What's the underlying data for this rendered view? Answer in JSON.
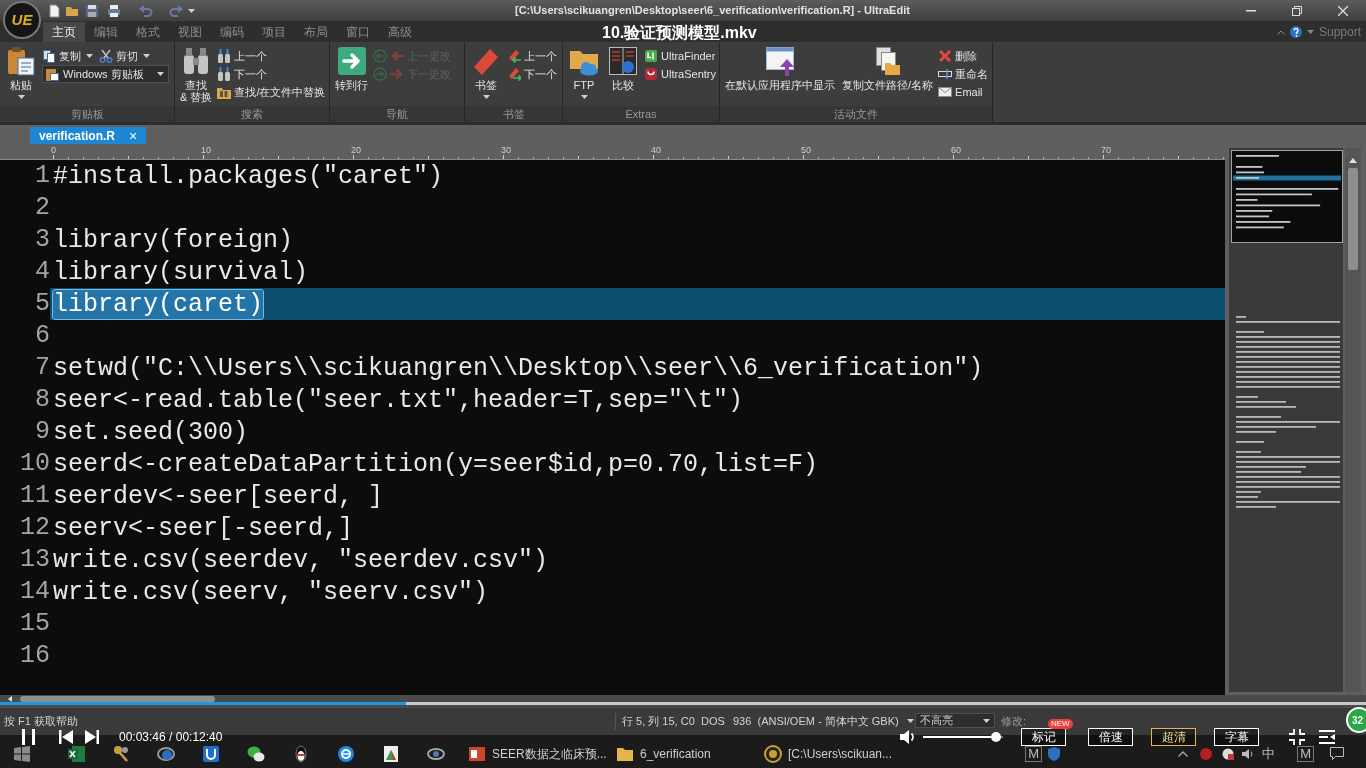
{
  "window": {
    "logo": "UE",
    "title": "[C:\\Users\\scikuangren\\Desktop\\seer\\6_verification\\verification.R] - UltraEdit"
  },
  "menu_tabs": [
    {
      "label": "主页",
      "selected": true
    },
    {
      "label": "编辑",
      "selected": false
    },
    {
      "label": "格式",
      "selected": false
    },
    {
      "label": "视图",
      "selected": false
    },
    {
      "label": "编码",
      "selected": false
    },
    {
      "label": "项目",
      "selected": false
    },
    {
      "label": "布局",
      "selected": false
    },
    {
      "label": "窗口",
      "selected": false
    },
    {
      "label": "高级",
      "selected": false
    }
  ],
  "support": {
    "label": "Support"
  },
  "ribbon": [
    {
      "label": "剪贴板",
      "columns": [
        {
          "kind": "large",
          "label": "粘贴",
          "dropdown": true
        },
        {
          "kind": "stack",
          "rows": [
            [
              {
                "kind": "button",
                "label": "复制",
                "dropdown": true
              },
              {
                "kind": "button",
                "label": "剪切",
                "dropdown": true
              }
            ],
            [
              {
                "kind": "combo",
                "label": "Windows 剪贴板"
              }
            ]
          ]
        }
      ]
    },
    {
      "label": "搜索",
      "columns": [
        {
          "kind": "large",
          "label": "查找\n& 替换"
        },
        {
          "kind": "stack",
          "rows": [
            [
              {
                "kind": "button",
                "label": "上一个"
              }
            ],
            [
              {
                "kind": "button",
                "label": "下一个"
              }
            ],
            [
              {
                "kind": "button",
                "label": "查找/在文件中替换"
              }
            ]
          ]
        }
      ]
    },
    {
      "label": "导航",
      "columns": [
        {
          "kind": "large",
          "label": "转到行"
        },
        {
          "kind": "stack",
          "rows": [
            [
              {
                "kind": "icon",
                "disabled": true
              }
            ],
            [
              {
                "kind": "icon",
                "disabled": true
              }
            ]
          ]
        },
        {
          "kind": "stack",
          "rows": [
            [
              {
                "kind": "button",
                "label": "上一更改",
                "disabled": true
              }
            ],
            [
              {
                "kind": "button",
                "label": "下一更改",
                "disabled": true
              }
            ]
          ]
        }
      ]
    },
    {
      "label": "书签",
      "columns": [
        {
          "kind": "large",
          "label": "书签",
          "dropdown": true
        },
        {
          "kind": "stack",
          "rows": [
            [
              {
                "kind": "button",
                "label": "上一个"
              }
            ],
            [
              {
                "kind": "button",
                "label": "下一个"
              }
            ]
          ]
        }
      ]
    },
    {
      "label": "Extras",
      "columns": [
        {
          "kind": "large",
          "label": "FTP",
          "dropdown": true
        },
        {
          "kind": "large",
          "label": "比较"
        },
        {
          "kind": "stack",
          "rows": [
            [
              {
                "kind": "button",
                "label": "UltraFinder"
              }
            ],
            [
              {
                "kind": "button",
                "label": "UltraSentry"
              }
            ]
          ]
        }
      ]
    },
    {
      "label": "活动文件",
      "columns": [
        {
          "kind": "large",
          "label": "在默认应用程序中显示"
        },
        {
          "kind": "large",
          "label": "复制文件路径/名称"
        },
        {
          "kind": "stack",
          "rows": [
            [
              {
                "kind": "button",
                "label": "删除"
              }
            ],
            [
              {
                "kind": "button",
                "label": "重命名"
              }
            ],
            [
              {
                "kind": "button",
                "label": "Email"
              }
            ]
          ]
        }
      ]
    }
  ],
  "file_tab": {
    "label": "verification.R",
    "close": "×"
  },
  "ruler": {
    "labels": [
      "0",
      "10",
      "20",
      "30",
      "40",
      "50",
      "60",
      "70"
    ]
  },
  "editor": {
    "lines": [
      {
        "number": "1",
        "text": "#install.packages(\"caret\")",
        "current": false,
        "selected": false
      },
      {
        "number": "2",
        "current": false,
        "selected": false
      },
      {
        "number": "3",
        "text": "library(foreign)",
        "current": false,
        "selected": false
      },
      {
        "number": "4",
        "text": "library(survival)",
        "current": false,
        "selected": false
      },
      {
        "number": "5",
        "text": "library(caret)",
        "current": true,
        "selected": true
      },
      {
        "number": "6",
        "current": false,
        "selected": false
      },
      {
        "number": "7",
        "text": "setwd(\"C:\\\\Users\\\\scikuangren\\\\Desktop\\\\seer\\\\6_verification\")",
        "current": false,
        "selected": false
      },
      {
        "number": "8",
        "text": "seer<-read.table(\"seer.txt\",header=T,sep=\"\\t\")",
        "current": false,
        "selected": false
      },
      {
        "number": "9",
        "text": "set.seed(300)",
        "current": false,
        "selected": false
      },
      {
        "number": "10",
        "text": "seerd<-createDataPartition(y=seer$id,p=0.70,list=F)",
        "current": false,
        "selected": false
      },
      {
        "number": "11",
        "text": "seerdev<-seer[seerd, ]",
        "current": false,
        "selected": false
      },
      {
        "number": "12",
        "text": "seerv<-seer[-seerd,]",
        "current": false,
        "selected": false
      },
      {
        "number": "13",
        "text": "write.csv(seerdev, \"seerdev.csv\")",
        "current": false,
        "selected": false
      },
      {
        "number": "14",
        "text": "write.csv(seerv, \"seerv.csv\")",
        "current": false,
        "selected": false
      },
      {
        "number": "15",
        "current": false,
        "selected": false
      },
      {
        "number": "16",
        "current": false,
        "selected": false
      }
    ]
  },
  "status_bar": {
    "help": "按 F1 获取帮助",
    "position": "行 5, 列 15, C0",
    "line_ending": "DOS",
    "encoding": "936  (ANSI/OEM - 简体中文 GBK)",
    "highlight": "不高亮",
    "modified": "修改:"
  },
  "player": {
    "title": "10.验证预测模型.mkv",
    "time": "00:03:46 / 00:12:40",
    "progress": {
      "level": 0.297
    },
    "volume": {
      "level": 0.97
    },
    "buttons": [
      {
        "label": "标记",
        "badge": "NEW",
        "selected": false
      },
      {
        "label": "倍速",
        "selected": false
      },
      {
        "label": "超清",
        "selected": true
      },
      {
        "label": "字幕",
        "selected": false
      }
    ]
  },
  "taskbar": {
    "apps": [
      {
        "label": "SEER数据之临床预..."
      },
      {
        "label": "6_verification"
      },
      {
        "label": "[C:\\Users\\scikuan..."
      }
    ],
    "tray_labels": [
      "M",
      "中",
      "M"
    ]
  },
  "corner_badge": {
    "label": "32"
  }
}
